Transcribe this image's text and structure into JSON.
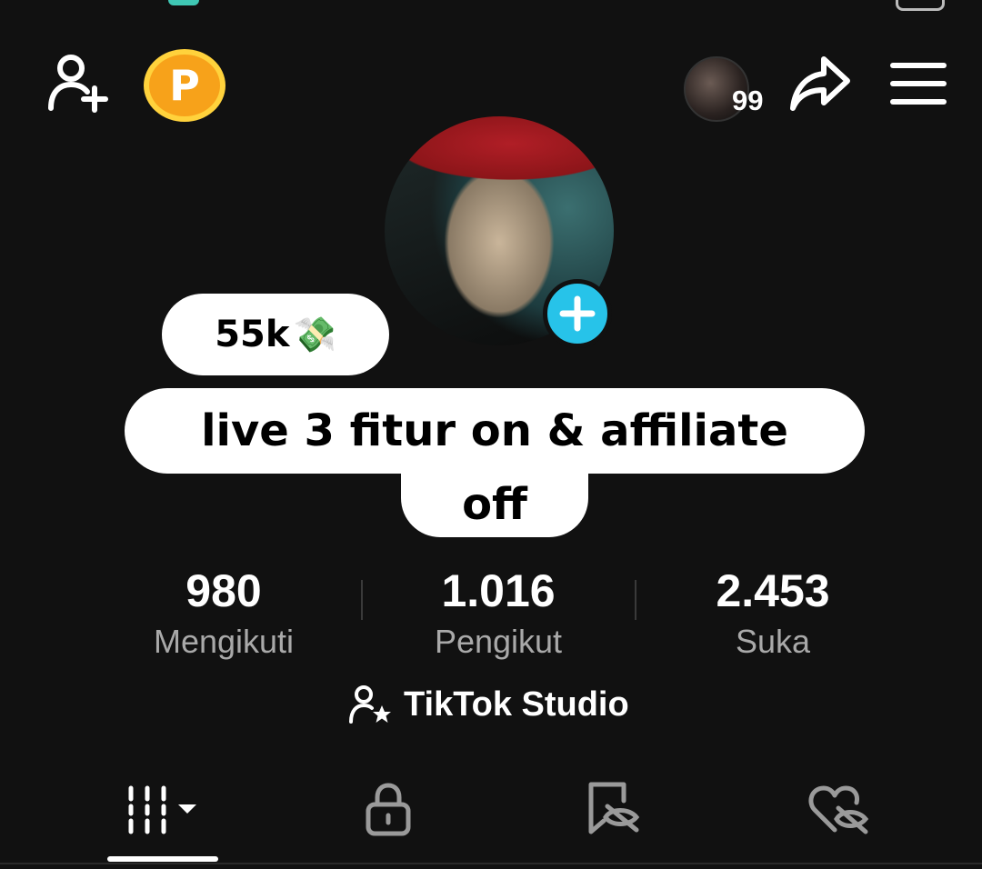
{
  "header": {
    "coin_label": "P",
    "story_count": "99"
  },
  "stickers": {
    "money_text": "55k",
    "money_emoji": "💸",
    "live_text": "live 3 fitur on & affiliate",
    "off_text": "off"
  },
  "stats": [
    {
      "value": "980",
      "label": "Mengikuti"
    },
    {
      "value": "1.016",
      "label": "Pengikut"
    },
    {
      "value": "2.453",
      "label": "Suka"
    }
  ],
  "studio": {
    "label": "TikTok Studio"
  },
  "tabs": [
    {
      "icon": "grid-icon",
      "active": true
    },
    {
      "icon": "lock-icon",
      "active": false
    },
    {
      "icon": "bookmark-hidden-icon",
      "active": false
    },
    {
      "icon": "heart-hidden-icon",
      "active": false
    }
  ],
  "colors": {
    "background": "#111111",
    "coin": "#f7a21a",
    "plus_badge": "#27c3e9",
    "sticker": "#ffffff",
    "label_gray": "#a9a9a9"
  }
}
